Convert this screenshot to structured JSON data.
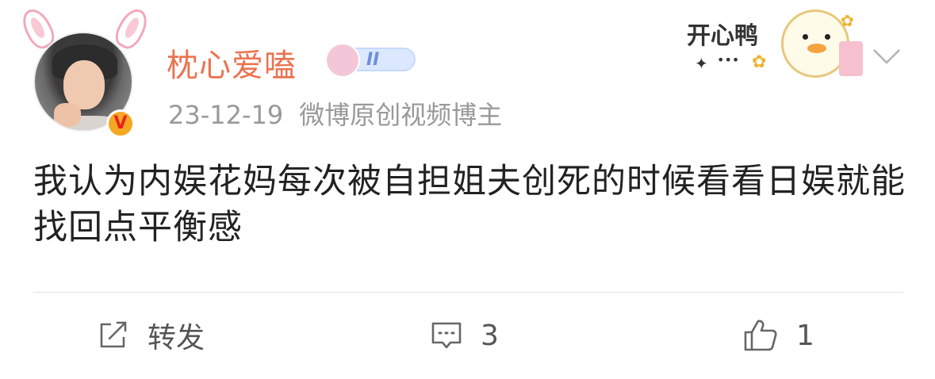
{
  "post": {
    "author": {
      "name": "枕心爱嗑",
      "level_badge": "II"
    },
    "meta": {
      "date": "23-12-19",
      "source": "微博原创视频博主"
    },
    "decoration_text": "开心鸭",
    "content": "我认为内娱花妈每次被自担姐夫创死的时候看看日娱就能找回点平衡感",
    "actions": {
      "repost": {
        "label": "转发",
        "icon": "share-icon"
      },
      "comment": {
        "count": "3",
        "icon": "comment-icon"
      },
      "like": {
        "count": "1",
        "icon": "thumbs-up-icon"
      }
    }
  },
  "colors": {
    "username": "#eb7350",
    "meta": "#999999",
    "text": "#222222",
    "verified": "#f5a623"
  }
}
